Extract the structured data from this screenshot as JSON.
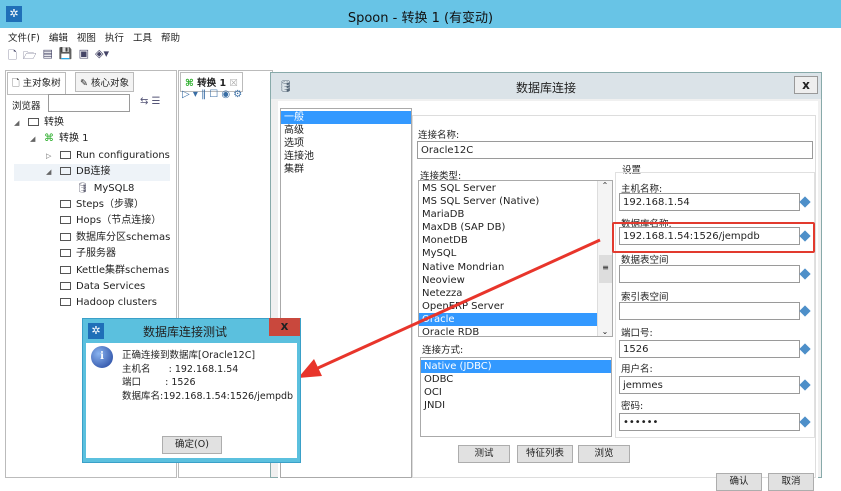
{
  "window": {
    "title": "Spoon - 转换 1 (有变动)"
  },
  "menu": [
    "文件(F)",
    "编辑",
    "视图",
    "执行",
    "工具",
    "帮助"
  ],
  "left_panel": {
    "tabs": [
      "主对象树",
      "核心对象"
    ],
    "browser_label": "浏览器",
    "search_value": "",
    "tree": [
      {
        "label": "转换",
        "level": 0,
        "toggle": "◢"
      },
      {
        "label": "转换 1",
        "level": 1,
        "toggle": "◢"
      },
      {
        "label": "Run configurations",
        "level": 2,
        "toggle": "▷"
      },
      {
        "label": "DB连接",
        "level": 2,
        "toggle": "◢"
      },
      {
        "label": "MySQL8",
        "level": 3,
        "toggle": ""
      },
      {
        "label": "Steps（步骤）",
        "level": 2,
        "toggle": ""
      },
      {
        "label": "Hops（节点连接）",
        "level": 2,
        "toggle": ""
      },
      {
        "label": "数据库分区schemas",
        "level": 2,
        "toggle": ""
      },
      {
        "label": "子服务器",
        "level": 2,
        "toggle": ""
      },
      {
        "label": "Kettle集群schemas",
        "level": 2,
        "toggle": ""
      },
      {
        "label": "Data Services",
        "level": 2,
        "toggle": ""
      },
      {
        "label": "Hadoop clusters",
        "level": 2,
        "toggle": ""
      }
    ]
  },
  "editor": {
    "tab_label": "转换 1"
  },
  "db_dialog": {
    "title": "数据库连接",
    "close": "x",
    "sections": [
      "一般",
      "高级",
      "选项",
      "连接池",
      "集群"
    ],
    "selected_section": "一般",
    "conn_name_label": "连接名称:",
    "conn_name": "Oracle12C",
    "conn_type_label": "连接类型:",
    "conn_types": [
      "MS SQL Server",
      "MS SQL Server (Native)",
      "MariaDB",
      "MaxDB (SAP DB)",
      "MonetDB",
      "MySQL",
      "Native Mondrian",
      "Neoview",
      "Netezza",
      "OpenERP Server",
      "Oracle",
      "Oracle RDB"
    ],
    "selected_type": "Oracle",
    "access_label": "连接方式:",
    "access_types": [
      "Native (JDBC)",
      "ODBC",
      "OCI",
      "JNDI"
    ],
    "selected_access": "Native (JDBC)",
    "settings_label": "设置",
    "host_label": "主机名称:",
    "host": "192.168.1.54",
    "db_label": "数据库名称:",
    "db": "192.168.1.54:1526/jempdb",
    "tablespace_label": "数据表空间",
    "tablespace": "",
    "index_label": "索引表空间",
    "index_tablespace": "",
    "port_label": "端口号:",
    "port": "1526",
    "user_label": "用户名:",
    "user": "jemmes",
    "password_label": "密码:",
    "password": "••••••",
    "buttons": {
      "test": "测试",
      "features": "特征列表",
      "explore": "浏览",
      "ok": "确认",
      "cancel": "取消"
    }
  },
  "test_dialog": {
    "title": "数据库连接测试",
    "close": "x",
    "lines": [
      "正确连接到数据库[Oracle12C]",
      "主机名      : 192.168.1.54",
      "端口        : 1526",
      "数据库名:192.168.1.54:1526/jempdb"
    ],
    "ok": "确定(O)"
  }
}
